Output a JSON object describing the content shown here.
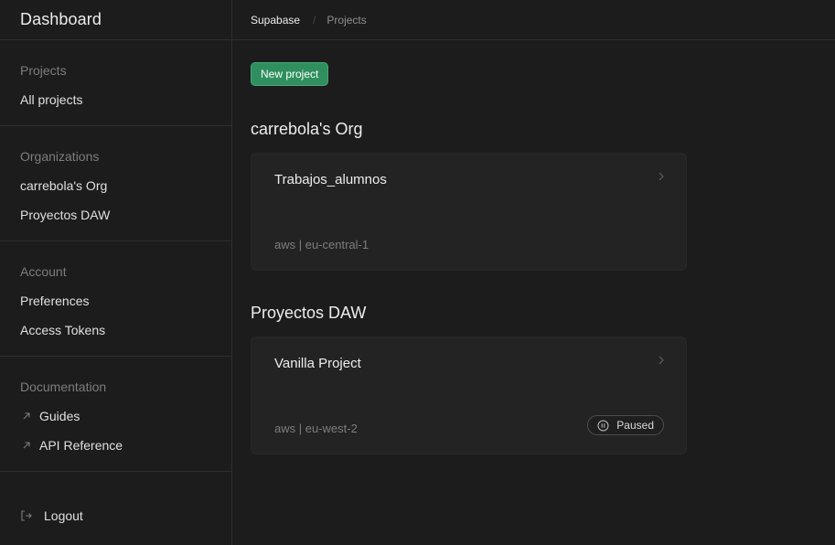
{
  "sidebar": {
    "title": "Dashboard",
    "sections": [
      {
        "title": "Projects",
        "items": [
          {
            "label": "All projects"
          }
        ]
      },
      {
        "title": "Organizations",
        "items": [
          {
            "label": "carrebola's Org"
          },
          {
            "label": "Proyectos DAW"
          }
        ]
      },
      {
        "title": "Account",
        "items": [
          {
            "label": "Preferences"
          },
          {
            "label": "Access Tokens"
          }
        ]
      },
      {
        "title": "Documentation",
        "items": [
          {
            "label": "Guides",
            "icon": "external-link-icon"
          },
          {
            "label": "API Reference",
            "icon": "external-link-icon"
          }
        ]
      }
    ],
    "logout": {
      "label": "Logout",
      "icon": "logout-icon"
    }
  },
  "breadcrumb": {
    "org": "Supabase",
    "separator": "/",
    "page": "Projects"
  },
  "main": {
    "new_project_label": "New project",
    "orgs": [
      {
        "name": "carrebola's Org",
        "projects": [
          {
            "name": "Trabajos_alumnos",
            "region": "aws | eu-central-1",
            "status": ""
          }
        ]
      },
      {
        "name": "Proyectos DAW",
        "projects": [
          {
            "name": "Vanilla Project",
            "region": "aws | eu-west-2",
            "status": "Paused"
          }
        ]
      }
    ]
  },
  "colors": {
    "background": "#1c1c1c",
    "card": "#232323",
    "accent": "#2f8f5e",
    "muted_text": "#7d7d7d"
  }
}
